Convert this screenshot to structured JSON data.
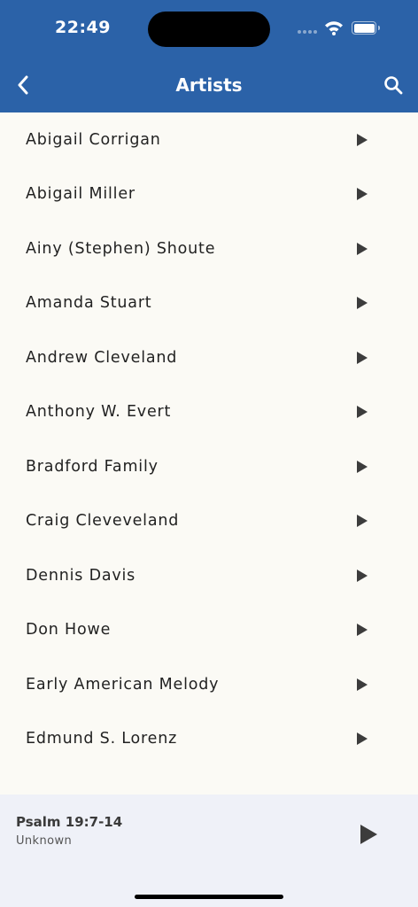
{
  "status_bar": {
    "time": "22:49"
  },
  "header": {
    "title": "Artists"
  },
  "artists": [
    {
      "name": "Abigail Corrigan"
    },
    {
      "name": "Abigail Miller"
    },
    {
      "name": "Ainy (Stephen) Shoute"
    },
    {
      "name": "Amanda Stuart"
    },
    {
      "name": "Andrew Cleveland"
    },
    {
      "name": "Anthony W. Evert"
    },
    {
      "name": "Bradford Family"
    },
    {
      "name": "Craig Cleveveland"
    },
    {
      "name": "Dennis Davis"
    },
    {
      "name": "Don Howe"
    },
    {
      "name": "Early American Melody"
    },
    {
      "name": "Edmund S. Lorenz"
    }
  ],
  "now_playing": {
    "track": "Psalm 19:7-14",
    "artist": "Unknown"
  },
  "colors": {
    "header_bg": "#2b62a8",
    "list_bg": "#fbfaf5",
    "player_bg": "#eff1f8",
    "icon": "#3c3c3c"
  }
}
